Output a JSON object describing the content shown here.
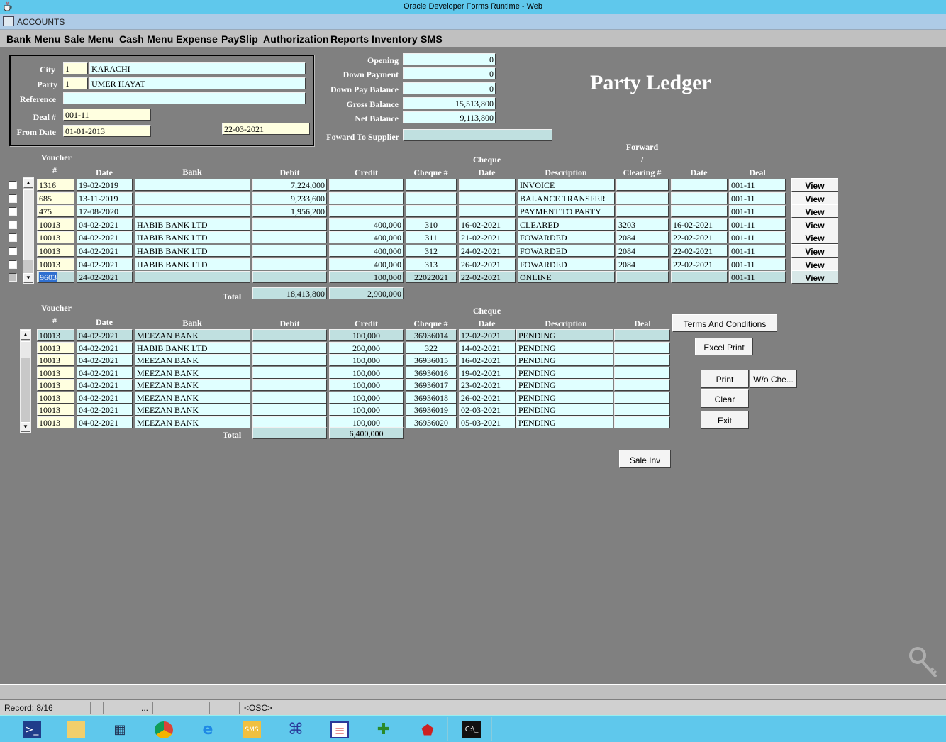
{
  "window": {
    "title": "Oracle Developer Forms Runtime - Web",
    "subtitle": "ACCOUNTS"
  },
  "menu": [
    "Bank Menu",
    "Sale Menu",
    "Cash Menu",
    "Expense",
    "PaySlip",
    "Authorization",
    "Reports",
    "Inventory",
    "SMS"
  ],
  "form_title": "Party Ledger",
  "header": {
    "city_label": "City",
    "city_code": "1",
    "city_name": "KARACHI",
    "party_label": "Party",
    "party_code": "1",
    "party_name": "UMER HAYAT",
    "reference_label": "Reference",
    "reference": "",
    "deal_label": "Deal #",
    "deal": "001-11",
    "from_label": "From Date",
    "from_date": "01-01-2013",
    "to_date": "22-03-2021"
  },
  "balances": {
    "opening_label": "Opening",
    "opening": "0",
    "down_payment_label": "Down Payment",
    "down_payment": "0",
    "down_pay_balance_label": "Down Pay Balance",
    "down_pay_balance": "0",
    "gross_balance_label": "Gross Balance",
    "gross_balance": "15,513,800",
    "net_balance_label": "Net Balance",
    "net_balance": "9,113,800",
    "forward_label": "Foward To Supplier",
    "forward_to_supplier": ""
  },
  "ledger": {
    "headers": {
      "voucher_top": "Voucher",
      "voucher_bottom": "#",
      "date": "Date",
      "bank": "Bank",
      "debit": "Debit",
      "credit": "Credit",
      "cheque_no": "Cheque  #",
      "cheque_date_top": "Cheque",
      "cheque_date_bottom": "Date",
      "description": "Description",
      "forward_top": "Forward",
      "forward_mid": "/",
      "clearing": "Clearing #",
      "clear_date": "Date",
      "deal": "Deal"
    },
    "rows": [
      {
        "voucher": "1316",
        "date": "19-02-2019",
        "bank": "",
        "debit": "7,224,000",
        "credit": "",
        "cheque": "",
        "cheque_date": "",
        "desc": "INVOICE",
        "clearing": "",
        "clear_date": "",
        "deal": "001-11",
        "view": "View"
      },
      {
        "voucher": "685",
        "date": "13-11-2019",
        "bank": "",
        "debit": "9,233,600",
        "credit": "",
        "cheque": "",
        "cheque_date": "",
        "desc": "BALANCE TRANSFER",
        "clearing": "",
        "clear_date": "",
        "deal": "001-11",
        "view": "View"
      },
      {
        "voucher": "475",
        "date": "17-08-2020",
        "bank": "",
        "debit": "1,956,200",
        "credit": "",
        "cheque": "",
        "cheque_date": "",
        "desc": "PAYMENT TO PARTY",
        "clearing": "",
        "clear_date": "",
        "deal": "001-11",
        "view": "View"
      },
      {
        "voucher": "10013",
        "date": "04-02-2021",
        "bank": "HABIB BANK LTD",
        "debit": "",
        "credit": "400,000",
        "cheque": "310",
        "cheque_date": "16-02-2021",
        "desc": "CLEARED",
        "clearing": "3203",
        "clear_date": "16-02-2021",
        "deal": "001-11",
        "view": "View"
      },
      {
        "voucher": "10013",
        "date": "04-02-2021",
        "bank": "HABIB BANK LTD",
        "debit": "",
        "credit": "400,000",
        "cheque": "311",
        "cheque_date": "21-02-2021",
        "desc": "FOWARDED",
        "clearing": "2084",
        "clear_date": "22-02-2021",
        "deal": "001-11",
        "view": "View"
      },
      {
        "voucher": "10013",
        "date": "04-02-2021",
        "bank": "HABIB BANK LTD",
        "debit": "",
        "credit": "400,000",
        "cheque": "312",
        "cheque_date": "24-02-2021",
        "desc": "FOWARDED",
        "clearing": "2084",
        "clear_date": "22-02-2021",
        "deal": "001-11",
        "view": "View"
      },
      {
        "voucher": "10013",
        "date": "04-02-2021",
        "bank": "HABIB BANK LTD",
        "debit": "",
        "credit": "400,000",
        "cheque": "313",
        "cheque_date": "26-02-2021",
        "desc": "FOWARDED",
        "clearing": "2084",
        "clear_date": "22-02-2021",
        "deal": "001-11",
        "view": "View"
      },
      {
        "voucher": "9603",
        "date": "24-02-2021",
        "bank": "",
        "debit": "",
        "credit": "100,000",
        "cheque": "22022021",
        "cheque_date": "22-02-2021",
        "desc": "ONLINE",
        "clearing": "",
        "clear_date": "",
        "deal": "001-11",
        "view": "View"
      }
    ],
    "total_label": "Total",
    "total_debit": "18,413,800",
    "total_credit": "2,900,000"
  },
  "pending": {
    "headers": {
      "voucher_top": "Voucher",
      "voucher_bottom": "#",
      "date": "Date",
      "bank": "Bank",
      "debit": "Debit",
      "credit": "Credit",
      "cheque_no": "Cheque  #",
      "cheque_date_top": "Cheque",
      "cheque_date_bottom": "Date",
      "description": "Description",
      "deal": "Deal"
    },
    "rows": [
      {
        "voucher": "10013",
        "date": "04-02-2021",
        "bank": "MEEZAN BANK",
        "debit": "",
        "credit": "100,000",
        "cheque": "36936014",
        "cheque_date": "12-02-2021",
        "desc": "PENDING",
        "deal": ""
      },
      {
        "voucher": "10013",
        "date": "04-02-2021",
        "bank": "HABIB BANK LTD",
        "debit": "",
        "credit": "200,000",
        "cheque": "322",
        "cheque_date": "14-02-2021",
        "desc": "PENDING",
        "deal": ""
      },
      {
        "voucher": "10013",
        "date": "04-02-2021",
        "bank": "MEEZAN BANK",
        "debit": "",
        "credit": "100,000",
        "cheque": "36936015",
        "cheque_date": "16-02-2021",
        "desc": "PENDING",
        "deal": ""
      },
      {
        "voucher": "10013",
        "date": "04-02-2021",
        "bank": "MEEZAN BANK",
        "debit": "",
        "credit": "100,000",
        "cheque": "36936016",
        "cheque_date": "19-02-2021",
        "desc": "PENDING",
        "deal": ""
      },
      {
        "voucher": "10013",
        "date": "04-02-2021",
        "bank": "MEEZAN BANK",
        "debit": "",
        "credit": "100,000",
        "cheque": "36936017",
        "cheque_date": "23-02-2021",
        "desc": "PENDING",
        "deal": ""
      },
      {
        "voucher": "10013",
        "date": "04-02-2021",
        "bank": "MEEZAN BANK",
        "debit": "",
        "credit": "100,000",
        "cheque": "36936018",
        "cheque_date": "26-02-2021",
        "desc": "PENDING",
        "deal": ""
      },
      {
        "voucher": "10013",
        "date": "04-02-2021",
        "bank": "MEEZAN BANK",
        "debit": "",
        "credit": "100,000",
        "cheque": "36936019",
        "cheque_date": "02-03-2021",
        "desc": "PENDING",
        "deal": ""
      },
      {
        "voucher": "10013",
        "date": "04-02-2021",
        "bank": "MEEZAN BANK",
        "debit": "",
        "credit": "100,000",
        "cheque": "36936020",
        "cheque_date": "05-03-2021",
        "desc": "PENDING",
        "deal": ""
      }
    ],
    "total_label": "Total",
    "total_debit": "",
    "total_credit": "6,400,000"
  },
  "buttons": {
    "terms": "Terms And Conditions",
    "excel": "Excel Print",
    "print": "Print",
    "wo_cheque": "W/o Che...",
    "clear": "Clear",
    "exit": "Exit",
    "sale_inv": "Sale Inv"
  },
  "status": {
    "record": "Record: 8/16",
    "dots": "...",
    "osc": "<OSC>"
  },
  "taskbar": [
    "powershell-icon",
    "file-explorer-icon",
    "network-icon",
    "chrome-icon",
    "internet-explorer-icon",
    "sms-mail-icon",
    "app-icon",
    "report-icon",
    "database-icon",
    "pdf-icon",
    "terminal-icon"
  ]
}
